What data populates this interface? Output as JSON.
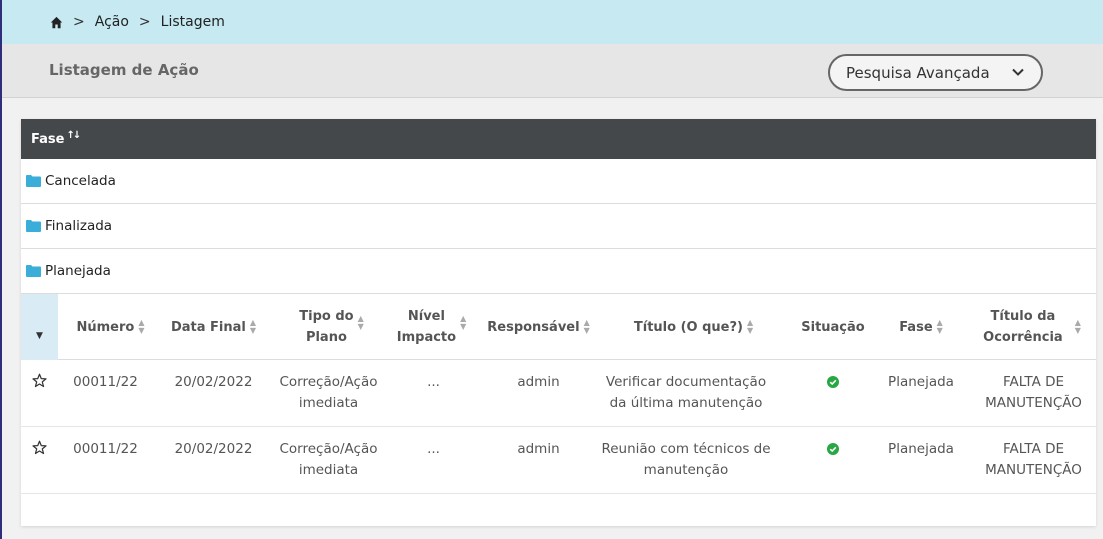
{
  "breadcrumb": {
    "items": [
      "Ação",
      "Listagem"
    ],
    "separator": ">"
  },
  "header": {
    "title": "Listagem de Ação",
    "advanced_search_label": "Pesquisa Avançada"
  },
  "group": {
    "header_label": "Fase",
    "folders": [
      "Cancelada",
      "Finalizada",
      "Planejada"
    ]
  },
  "table": {
    "columns": {
      "numero": "Número",
      "data_final": "Data Final",
      "tipo_plano_1": "Tipo do",
      "tipo_plano_2": "Plano",
      "nivel_1": "Nível",
      "nivel_2": "Impacto",
      "responsavel": "Responsável",
      "titulo": "Título (O que?)",
      "situacao": "Situação",
      "fase": "Fase",
      "titulo_oc_1": "Título da",
      "titulo_oc_2": "Ocorrência"
    },
    "rows": [
      {
        "numero": "00011/22",
        "data_final": "20/02/2022",
        "tipo_1": "Correção/Ação",
        "tipo_2": "imediata",
        "nivel": "...",
        "responsavel": "admin",
        "titulo_1": "Verificar documentação",
        "titulo_2": "da última manutenção",
        "situacao": "check-circle-icon",
        "fase": "Planejada",
        "oc_1": "FALTA DE",
        "oc_2": "MANUTENÇÃO"
      },
      {
        "numero": "00011/22",
        "data_final": "20/02/2022",
        "tipo_1": "Correção/Ação",
        "tipo_2": "imediata",
        "nivel": "...",
        "responsavel": "admin",
        "titulo_1": "Reunião com técnicos de",
        "titulo_2": "manutenção",
        "situacao": "check-circle-icon",
        "fase": "Planejada",
        "oc_1": "FALTA DE",
        "oc_2": "MANUTENÇÃO"
      }
    ]
  },
  "colors": {
    "breadcrumb_bg": "#c6e9f2",
    "group_header_bg": "#45484b",
    "folder": "#3aaed8",
    "status_ok": "#28a745"
  }
}
